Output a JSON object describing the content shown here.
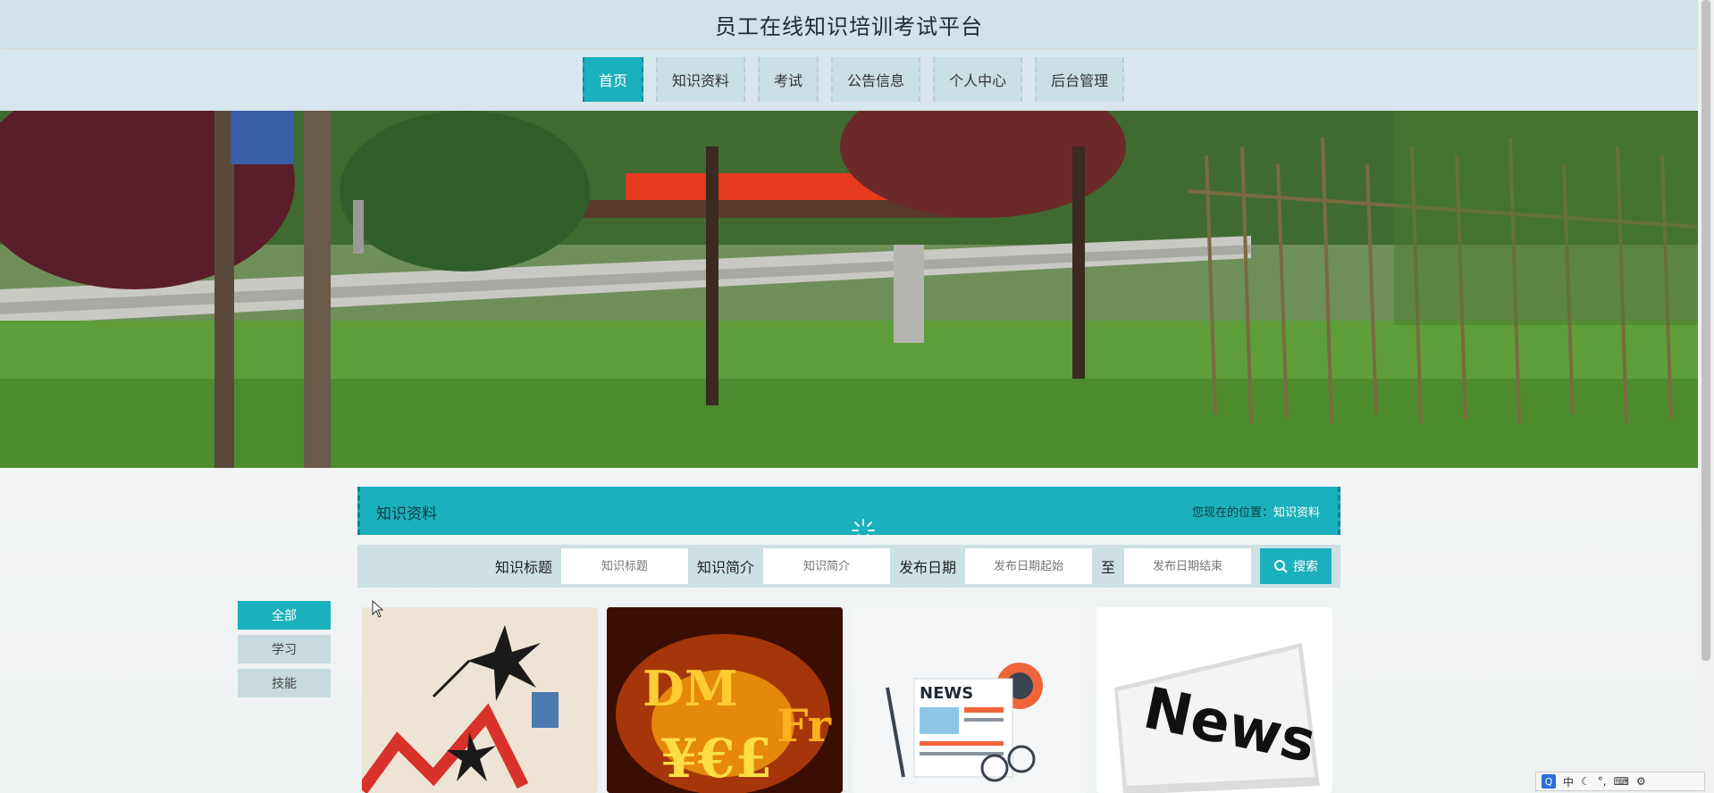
{
  "header": {
    "title": "员工在线知识培训考试平台"
  },
  "nav": {
    "items": [
      {
        "label": "首页",
        "active": true
      },
      {
        "label": "知识资料",
        "active": false
      },
      {
        "label": "考试",
        "active": false
      },
      {
        "label": "公告信息",
        "active": false
      },
      {
        "label": "个人中心",
        "active": false
      },
      {
        "label": "后台管理",
        "active": false
      }
    ]
  },
  "section": {
    "title": "知识资料",
    "breadcrumb_prefix": "您现在的位置：",
    "breadcrumb_current": "知识资料"
  },
  "search": {
    "title_label": "知识标题",
    "title_placeholder": "知识标题",
    "intro_label": "知识简介",
    "intro_placeholder": "知识简介",
    "date_label": "发布日期",
    "date_start_placeholder": "发布日期起始",
    "date_sep": "至",
    "date_end_placeholder": "发布日期结束",
    "button_label": "搜索",
    "button_icon": "search-icon"
  },
  "categories": [
    {
      "label": "全部",
      "active": true
    },
    {
      "label": "学习",
      "active": false
    },
    {
      "label": "技能",
      "active": false
    }
  ],
  "cards": [
    {
      "image": "stock-chart-illustration"
    },
    {
      "image": "fire-currency-symbols"
    },
    {
      "image": "news-flat-illustration"
    },
    {
      "image": "news-newspaper"
    }
  ],
  "ime": {
    "mode": "中"
  },
  "colors": {
    "accent": "#1bb0bd",
    "header": "#cfe3e8",
    "nav": "#d8e7ee"
  }
}
